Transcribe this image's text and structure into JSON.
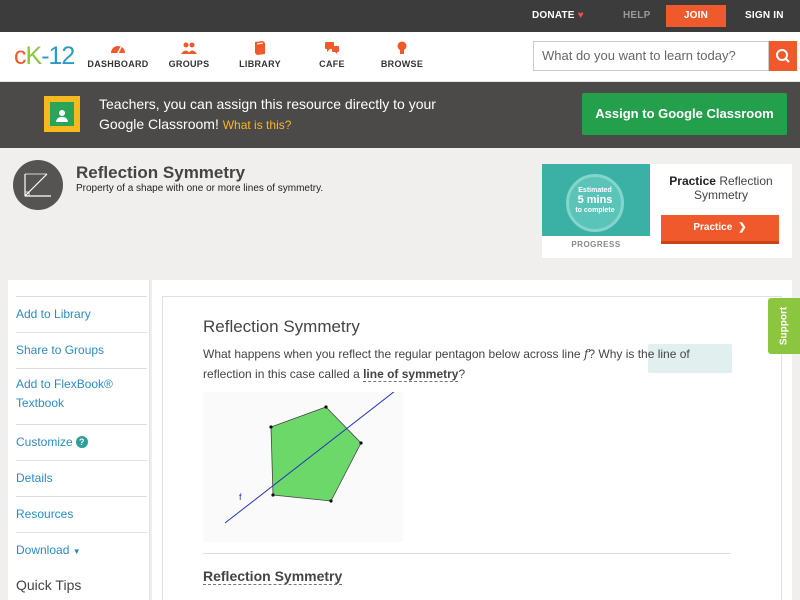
{
  "topbar": {
    "donate": "DONATE",
    "help": "HELP",
    "join": "JOIN",
    "signin": "SIGN IN"
  },
  "nav": {
    "logo": {
      "part1": "c",
      "part2": "K",
      "part3": "-12"
    },
    "items": [
      {
        "label": "DASHBOARD",
        "icon": "gauge-icon"
      },
      {
        "label": "GROUPS",
        "icon": "people-icon"
      },
      {
        "label": "LIBRARY",
        "icon": "book-icon"
      },
      {
        "label": "CAFE",
        "icon": "chat-icon"
      },
      {
        "label": "BROWSE",
        "icon": "lightbulb-icon"
      }
    ],
    "search_placeholder": "What do you want to learn today?"
  },
  "banner": {
    "text": "Teachers, you can assign this resource directly to your Google Classroom!",
    "link": "What is this?",
    "button": "Assign to Google Classroom"
  },
  "header": {
    "title": "Reflection Symmetry",
    "subtitle": "Property of a shape with one or more lines of symmetry."
  },
  "practice": {
    "badge_line1": "Estimated",
    "badge_line2": "5 mins",
    "badge_line3": "to complete",
    "progress": "PROGRESS",
    "title_bold": "Practice",
    "title_rest": "Reflection Symmetry",
    "button": "Practice"
  },
  "sidebar": {
    "items": [
      "Add to Library",
      "Share to Groups",
      "Add to FlexBook® Textbook",
      "Customize",
      "Details",
      "Resources",
      "Download"
    ],
    "quick_tips": "Quick Tips"
  },
  "content": {
    "title": "Reflection Symmetry",
    "para_a": "What happens when you reflect the regular pentagon below across line ",
    "var": "f",
    "para_b": "? Why is the line of reflection in this case called a ",
    "term": "line of symmetry",
    "para_c": "?",
    "figure_label": "f",
    "section": "Reflection Symmetry"
  },
  "support": "Support",
  "colors": {
    "brand_orange": "#f0592b",
    "brand_green": "#8cc540",
    "brand_blue": "#2d9bc7",
    "google_green": "#24a04c",
    "pentagon_fill": "#6dd86a"
  }
}
